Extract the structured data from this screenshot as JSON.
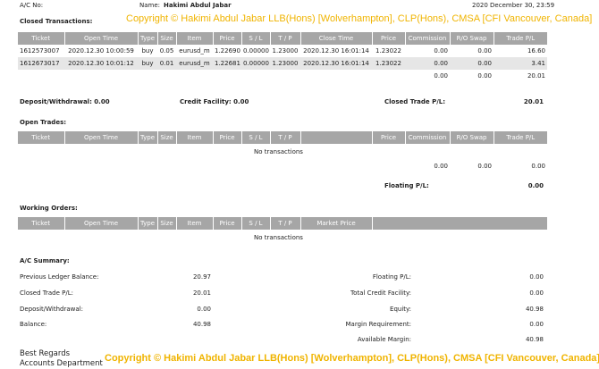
{
  "header": {
    "ac_no_label": "A/C No:",
    "name_label": "Name:",
    "name_value": "Hakimi Abdul Jabar",
    "date": "2020 December 30, 23:59"
  },
  "watermark_top": "Copyright © Hakimi Abdul Jabar LLB(Hons) [Wolverhampton], CLP(Hons), CMSA [CFI Vancouver, Canada]",
  "watermark_bottom": "Copyright © Hakimi Abdul Jabar LLB(Hons) [Wolverhampton], CLP(Hons), CMSA [CFI Vancouver, Canada]",
  "closed": {
    "title": "Closed Transactions:",
    "headers": [
      "Ticket",
      "Open Time",
      "Type",
      "Size",
      "Item",
      "Price",
      "S / L",
      "T / P",
      "Close Time",
      "Price",
      "Commission",
      "R/O Swap",
      "Trade P/L"
    ],
    "rows": [
      [
        "1612573007",
        "2020.12.30 10:00:59",
        "buy",
        "0.05",
        "eurusd_m",
        "1.22690",
        "0.00000",
        "1.23000",
        "2020.12.30 16:01:14",
        "1.23022",
        "0.00",
        "0.00",
        "16.60"
      ],
      [
        "1612673017",
        "2020.12.30 10:01:12",
        "buy",
        "0.01",
        "eurusd_m",
        "1.22681",
        "0.00000",
        "1.23000",
        "2020.12.30 16:01:14",
        "1.23022",
        "0.00",
        "0.00",
        "3.41"
      ]
    ],
    "totals": {
      "commission": "0.00",
      "swap": "0.00",
      "pl": "20.01"
    },
    "deposit_withdrawal": "Deposit/Withdrawal: 0.00",
    "credit_facility": "Credit Facility: 0.00",
    "closed_pl_label": "Closed Trade P/L:",
    "closed_pl_value": "20.01"
  },
  "open": {
    "title": "Open Trades:",
    "headers": [
      "Ticket",
      "Open Time",
      "Type",
      "Size",
      "Item",
      "Price",
      "S / L",
      "T / P",
      "",
      "Price",
      "Commission",
      "R/O Swap",
      "Trade P/L"
    ],
    "empty": "No transactions",
    "totals": {
      "commission": "0.00",
      "swap": "0.00",
      "pl": "0.00"
    },
    "floating_label": "Floating P/L:",
    "floating_value": "0.00"
  },
  "working": {
    "title": "Working Orders:",
    "headers": [
      "Ticket",
      "Open Time",
      "Type",
      "Size",
      "Item",
      "Price",
      "S / L",
      "T / P",
      "Market Price",
      ""
    ],
    "empty": "No transactions"
  },
  "summary": {
    "title": "A/C Summary:",
    "left": [
      {
        "label": "Previous Ledger Balance:",
        "value": "20.97"
      },
      {
        "label": "Closed Trade P/L:",
        "value": "20.01"
      },
      {
        "label": "Deposit/Withdrawal:",
        "value": "0.00"
      },
      {
        "label": "Balance:",
        "value": "40.98"
      }
    ],
    "right": [
      {
        "label": "Floating P/L:",
        "value": "0.00"
      },
      {
        "label": "Total Credit Facility:",
        "value": "0.00"
      },
      {
        "label": "Equity:",
        "value": "40.98"
      },
      {
        "label": "Margin Requirement:",
        "value": "0.00"
      },
      {
        "label": "Available Margin:",
        "value": "40.98"
      }
    ]
  },
  "footer": {
    "regards": "Best Regards",
    "department": "Accounts Department"
  }
}
